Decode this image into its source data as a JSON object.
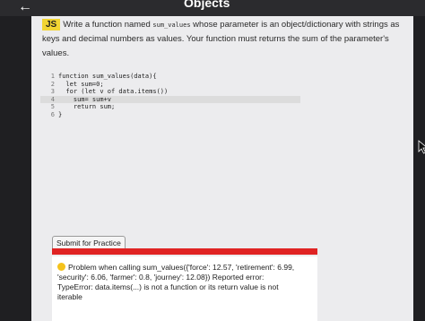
{
  "header": {
    "title": "Objects"
  },
  "prompt": {
    "badge": "JS",
    "before": "Write a function named ",
    "function_name": "sum_values",
    "after": " whose parameter is an object/dictionary with strings as keys and decimal numbers as values. Your function must returns the sum of the parameter's values."
  },
  "editor": {
    "lines": [
      {
        "num": "1",
        "code": "function sum_values(data){"
      },
      {
        "num": "2",
        "code": "  let sum=0;"
      },
      {
        "num": "3",
        "code": "  for (let v of data.items())"
      },
      {
        "num": "4",
        "code": "    sum= sum+v"
      },
      {
        "num": "5",
        "code": "    return sum;"
      },
      {
        "num": "6",
        "code": "}"
      }
    ]
  },
  "submit": {
    "label": "Submit for Practice"
  },
  "result": {
    "status_color": "#e02323",
    "message": "Problem when calling sum_values({'force': 12.57, 'retirement': 6.99, 'security': 6.06, 'farmer': 0.8, 'journey': 12.08}) Reported error: TypeError: data.items(...) is not a function or its return value is not iterable"
  }
}
